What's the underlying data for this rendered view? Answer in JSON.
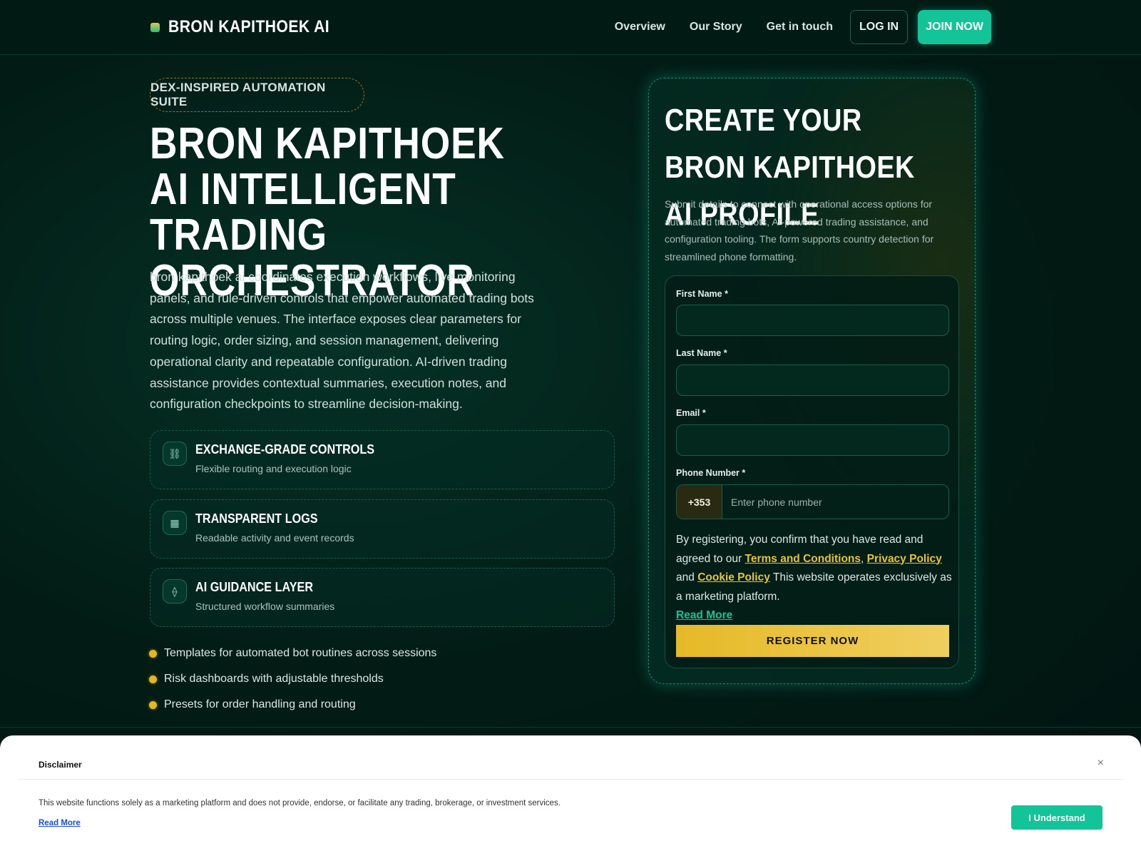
{
  "header": {
    "brand": "BRON KAPITHOEK AI",
    "nav": [
      "Overview",
      "Our Story",
      "Get in touch"
    ],
    "login_label": "LOG IN",
    "join_label": "JOIN NOW"
  },
  "hero": {
    "pill": "DEX-INSPIRED AUTOMATION SUITE",
    "title": "BRON KAPITHOEK AI INTELLIGENT TRADING ORCHESTRATOR",
    "description": "bron kapithoek ai coordinates execution workflows, live monitoring panels, and rule-driven controls that empower automated trading bots across multiple venues. The interface exposes clear parameters for routing logic, order sizing, and session management, delivering operational clarity and repeatable configuration. AI-driven trading assistance provides contextual summaries, execution notes, and configuration checkpoints to streamline decision-making.",
    "features": [
      {
        "icon": "link-icon",
        "glyph": "⛓",
        "title": "EXCHANGE-GRADE CONTROLS",
        "subtitle": "Flexible routing and execution logic"
      },
      {
        "icon": "grid-icon",
        "glyph": "▦",
        "title": "TRANSPARENT LOGS",
        "subtitle": "Readable activity and event records"
      },
      {
        "icon": "diamond-icon",
        "glyph": "⟠",
        "title": "AI GUIDANCE LAYER",
        "subtitle": "Structured workflow summaries"
      }
    ],
    "bullets": [
      "Templates for automated bot routines across sessions",
      "Risk dashboards with adjustable thresholds",
      "Presets for order handling and routing"
    ]
  },
  "form": {
    "title": "CREATE YOUR BRON KAPITHOEK AI PROFILE",
    "description": "Submit details to connect with operational access options for automated trading bots, AI-powered trading assistance, and configuration tooling. The form supports country detection for streamlined phone formatting.",
    "first_name_label": "First Name *",
    "first_name_value": "",
    "last_name_label": "Last Name *",
    "last_name_value": "",
    "email_label": "Email *",
    "email_value": "",
    "phone_label": "Phone Number *",
    "phone_code": "+353",
    "phone_placeholder": "Enter phone number",
    "consent_prefix": "By registering, you confirm that you have read and agreed to our",
    "terms": "Terms and Conditions",
    "comma": ",",
    "privacy": "Privacy Policy",
    "and": "and",
    "cookie": "Cookie Policy",
    "marketing_note": "This website operates exclusively as a marketing platform.",
    "read_more": "Read More",
    "register_label": "REGISTER NOW"
  },
  "disclaimer": {
    "title": "Disclaimer",
    "close": "×",
    "text": "This website functions solely as a marketing platform and does not provide, endorse, or facilitate any trading, brokerage, or investment services.",
    "read_more": "Read More",
    "understand_label": "I Understand"
  },
  "colors": {
    "accent_green": "#12c497",
    "accent_gold": "#e5b927",
    "background": "#021c15"
  }
}
